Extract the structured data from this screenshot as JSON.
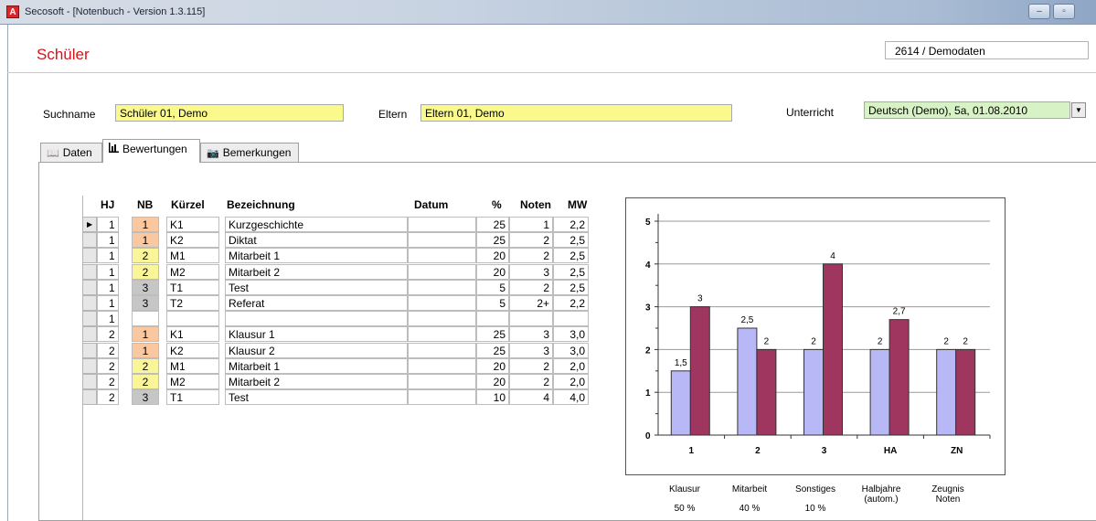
{
  "window": {
    "title": "Secosoft - [Notenbuch - Version 1.3.115]",
    "app_icon_letter": "A",
    "minimize_glyph": "–",
    "maximize_glyph": "▫"
  },
  "page": {
    "title": "Schüler",
    "ident": "2614 / Demodaten"
  },
  "search": {
    "suchname_label": "Suchname",
    "suchname_value": "Schüler 01, Demo",
    "eltern_label": "Eltern",
    "eltern_value": "Eltern 01, Demo",
    "unterricht_label": "Unterricht",
    "unterricht_value": "Deutsch (Demo), 5a, 01.08.2010"
  },
  "tabs": [
    {
      "label": "Daten",
      "icon": "book-icon",
      "active": false
    },
    {
      "label": "Bewertungen",
      "icon": "chart-icon",
      "active": true
    },
    {
      "label": "Bemerkungen",
      "icon": "camera-icon",
      "active": false
    }
  ],
  "grid": {
    "headers": [
      "HJ",
      "NB",
      "Kürzel",
      "Bezeichnung",
      "Datum",
      "%",
      "Noten",
      "MW"
    ],
    "rows": [
      {
        "hj": "1",
        "nb": "1",
        "nb_color": "#f9c8a0",
        "k": "K1",
        "b": "Kurzgeschichte",
        "d": "",
        "p": "25",
        "n": "1",
        "m": "2,2",
        "current": true
      },
      {
        "hj": "1",
        "nb": "1",
        "nb_color": "#f9c8a0",
        "k": "K2",
        "b": "Diktat",
        "d": "",
        "p": "25",
        "n": "2",
        "m": "2,5"
      },
      {
        "hj": "1",
        "nb": "2",
        "nb_color": "#fbf59a",
        "k": "M1",
        "b": "Mitarbeit 1",
        "d": "",
        "p": "20",
        "n": "2",
        "m": "2,5"
      },
      {
        "hj": "1",
        "nb": "2",
        "nb_color": "#fbf59a",
        "k": "M2",
        "b": "Mitarbeit 2",
        "d": "",
        "p": "20",
        "n": "3",
        "m": "2,5"
      },
      {
        "hj": "1",
        "nb": "3",
        "nb_color": "#c6c6c6",
        "k": "T1",
        "b": "Test",
        "d": "",
        "p": "5",
        "n": "2",
        "m": "2,5"
      },
      {
        "hj": "1",
        "nb": "3",
        "nb_color": "#c6c6c6",
        "k": "T2",
        "b": "Referat",
        "d": "",
        "p": "5",
        "n": "2+",
        "m": "2,2"
      },
      {
        "hj": "1",
        "nb": "",
        "nb_color": "#ffffff",
        "k": "",
        "b": "",
        "d": "",
        "p": "",
        "n": "",
        "m": ""
      },
      {
        "hj": "2",
        "nb": "1",
        "nb_color": "#f9c8a0",
        "k": "K1",
        "b": "Klausur 1",
        "d": "",
        "p": "25",
        "n": "3",
        "m": "3,0"
      },
      {
        "hj": "2",
        "nb": "1",
        "nb_color": "#f9c8a0",
        "k": "K2",
        "b": "Klausur 2",
        "d": "",
        "p": "25",
        "n": "3",
        "m": "3,0"
      },
      {
        "hj": "2",
        "nb": "2",
        "nb_color": "#fbf59a",
        "k": "M1",
        "b": "Mitarbeit 1",
        "d": "",
        "p": "20",
        "n": "2",
        "m": "2,0"
      },
      {
        "hj": "2",
        "nb": "2",
        "nb_color": "#fbf59a",
        "k": "M2",
        "b": "Mitarbeit 2",
        "d": "",
        "p": "20",
        "n": "2",
        "m": "2,0"
      },
      {
        "hj": "2",
        "nb": "3",
        "nb_color": "#c6c6c6",
        "k": "T1",
        "b": "Test",
        "d": "",
        "p": "10",
        "n": "4",
        "m": "4,0"
      }
    ]
  },
  "chart_data": {
    "type": "bar",
    "categories": [
      "1",
      "2",
      "3",
      "HA",
      "ZN"
    ],
    "series": [
      {
        "values": [
          1.5,
          2.5,
          2,
          2,
          2
        ],
        "labels": [
          "1,5",
          "2,5",
          "2",
          "2",
          "2"
        ],
        "color": "#b8b8f6"
      },
      {
        "values": [
          3,
          2,
          4,
          2.7,
          2
        ],
        "labels": [
          "3",
          "2",
          "4",
          "2,7",
          "2"
        ],
        "color": "#9e3660"
      }
    ],
    "ylim": [
      0,
      5
    ],
    "yticks": [
      "0",
      "1",
      "2",
      "3",
      "4",
      "5"
    ],
    "grid": true
  },
  "weights": [
    {
      "label": "Klausur",
      "value": "50 %"
    },
    {
      "label": "Mitarbeit",
      "value": "40 %"
    },
    {
      "label": "Sonstiges",
      "value": "10 %"
    },
    {
      "label": "Halbjahre (autom.)",
      "value": ""
    },
    {
      "label": "Zeugnis Noten",
      "value": ""
    }
  ]
}
